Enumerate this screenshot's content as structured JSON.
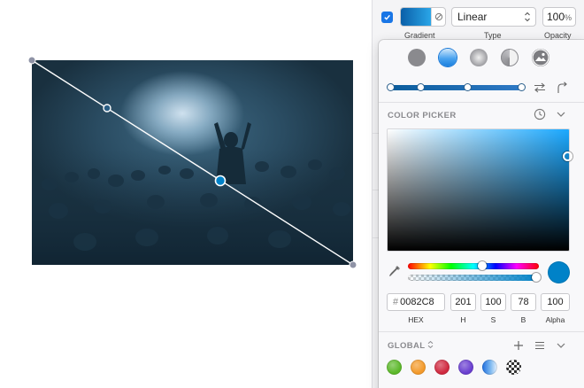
{
  "inspector": {
    "gradient_type": "Linear",
    "opacity_value": "100",
    "opacity_unit": "%",
    "labels": {
      "gradient": "Gradient",
      "type": "Type",
      "opacity": "Opacity"
    }
  },
  "popover": {
    "fill_types": [
      "solid-fill",
      "linear-gradient",
      "radial-gradient",
      "angular-gradient",
      "pattern-fill"
    ],
    "gradient_stops": [
      0.0,
      0.23,
      0.59,
      1.0
    ],
    "color_picker_title": "COLOR PICKER",
    "hex": "0082C8",
    "h": "201",
    "s": "100",
    "b": "78",
    "alpha": "100",
    "field_labels": {
      "hex": "HEX",
      "h": "H",
      "s": "S",
      "b": "B",
      "alpha": "Alpha"
    },
    "hue_level": 0.56,
    "alpha_level": 1.0,
    "current_color": "#0082C8",
    "global_title": "GLOBAL",
    "presets": [
      "#5cb82a",
      "#f39a2b",
      "#d0293f",
      "#6a3fd0",
      "blue-to-white-gradient",
      "checker-pattern"
    ]
  },
  "canvas": {
    "accent": "#0082C8"
  }
}
